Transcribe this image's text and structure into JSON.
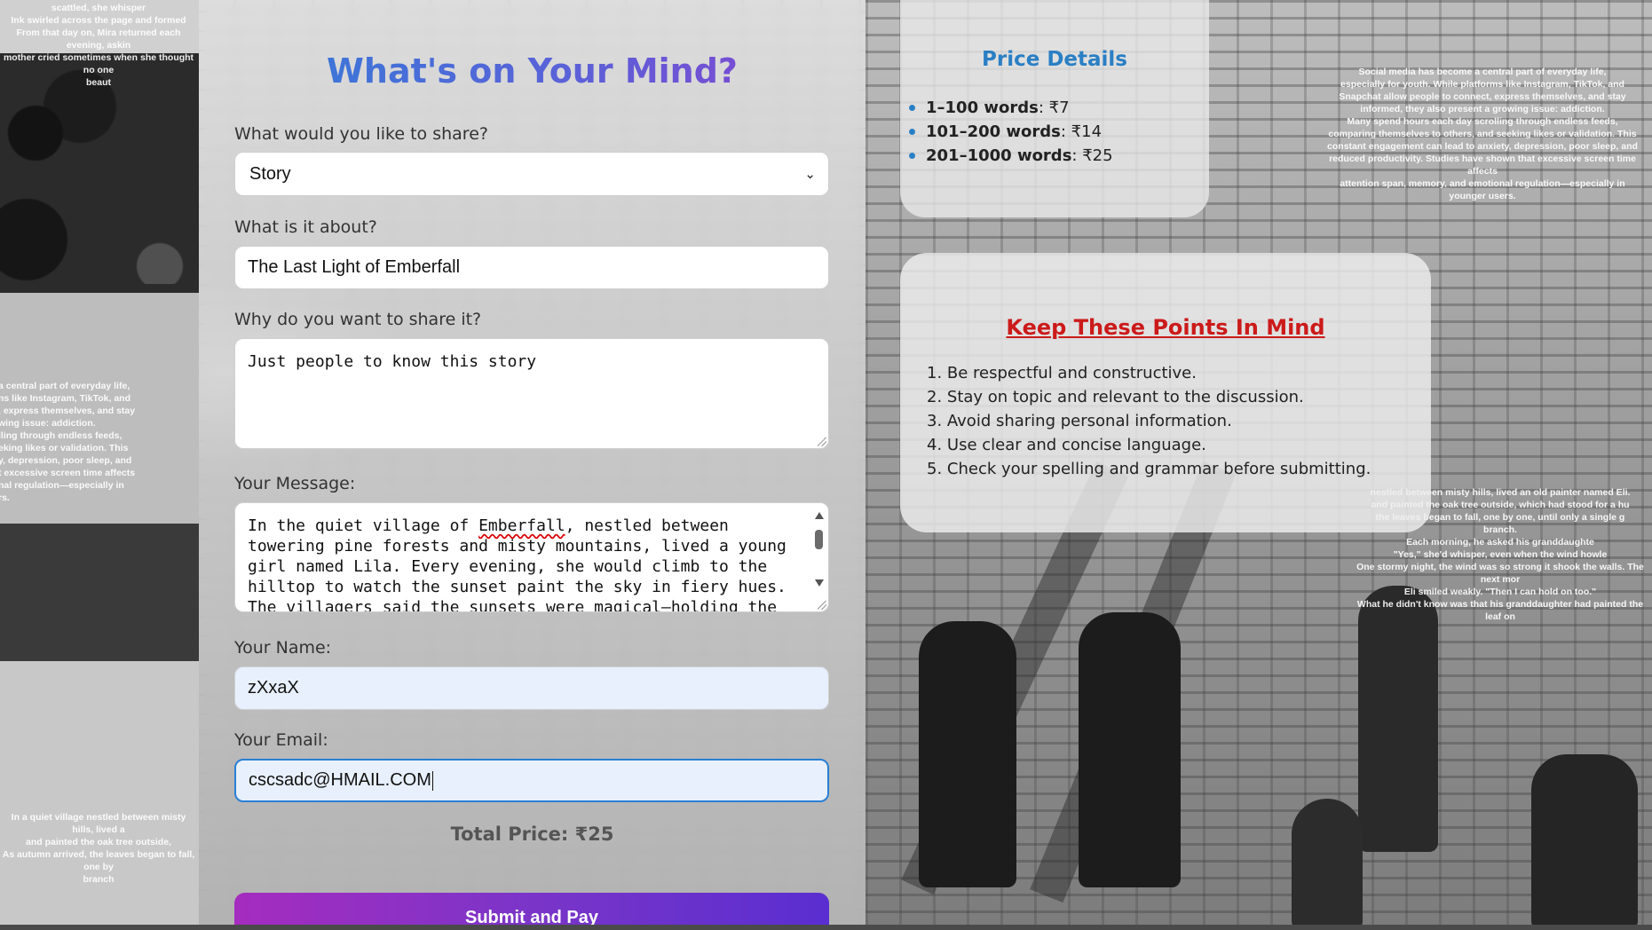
{
  "form": {
    "title": "What's on Your Mind?",
    "share_type": {
      "label": "What would you like to share?",
      "value": "Story"
    },
    "about": {
      "label": "What is it about?",
      "value": "The Last Light of Emberfall"
    },
    "why": {
      "label": "Why do you want to share it?",
      "value": "Just people to know this story"
    },
    "message": {
      "label": "Your Message:",
      "lines": [
        "In the quiet village of ",
        "Emberfall",
        ", nestled between",
        "towering pine forests and misty mountains, lived a young",
        "girl named Lila. Every evening, she would climb to the",
        "hilltop to watch the sunset paint the sky in fiery hues.",
        "The villagers said the sunsets were magical—holding the"
      ]
    },
    "name": {
      "label": "Your Name:",
      "value": "zXxaX"
    },
    "email": {
      "label": "Your Email:",
      "value": "cscsadc@HMAIL.COM"
    },
    "total_price": "Total Price: ₹25",
    "submit_label": "Submit and Pay"
  },
  "price_details": {
    "title": "Price Details",
    "items": [
      {
        "range": "1–100 words",
        "price": ": ₹7"
      },
      {
        "range": "101–200 words",
        "price": ": ₹14"
      },
      {
        "range": "201–1000 words",
        "price": ": ₹25"
      }
    ]
  },
  "points": {
    "title": "Keep These Points In Mind",
    "items": [
      "1. Be respectful and constructive.",
      "2. Stay on topic and relevant to the discussion.",
      "3. Avoid sharing personal information.",
      "4. Use clear and concise language.",
      "5. Check your spelling and grammar before submitting."
    ]
  },
  "background_text": {
    "left_top": "scattled, she whisper\nInk swirled across the page and formed\nFrom that day on, Mira returned each evening, askin\nmother cried sometimes when she thought no one\nbeaut",
    "left_mid": "a central part of everyday life,\nns like Instagram, TikTok, and\n, express themselves, and stay\nwing issue: addiction.\nlling through endless feeds,\neking likes or validation. This\ny, depression, poor sleep, and\nt excessive screen time affects\nnal regulation—especially in\nrs.",
    "left_bot": "In a quiet village nestled between misty hills, lived a\nand painted the oak tree outside,\nAs autumn arrived, the leaves began to fall, one by\nbranch",
    "right_top": "Social media has become a central part of everyday life,\nespecially for youth. While platforms like Instagram, TikTok, and\nSnapchat allow people to connect, express themselves, and stay\ninformed, they also present a growing issue: addiction.\nMany spend hours each day scrolling through endless feeds,\ncomparing themselves to others, and seeking likes or validation. This\nconstant engagement can lead to anxiety, depression, poor sleep, and\nreduced productivity. Studies have shown that excessive screen time affects\nattention span, memory, and emotional regulation—especially in\nyounger users.",
    "right_mid": "nestled between misty hills, lived an old painter named Eli.\nand painted the oak tree outside, which had stood for a hu\nthe leaves began to fall, one by one, until only a single g\nbranch.\nEach morning, he asked his granddaughte\n\"Yes,\" she'd whisper, even when the wind howle\nOne stormy night, the wind was so strong it shook the walls. The next mor\nEli smiled weakly. \"Then I can hold on too.\"\nWhat he didn't know was that his granddaughter had painted the leaf on"
  }
}
